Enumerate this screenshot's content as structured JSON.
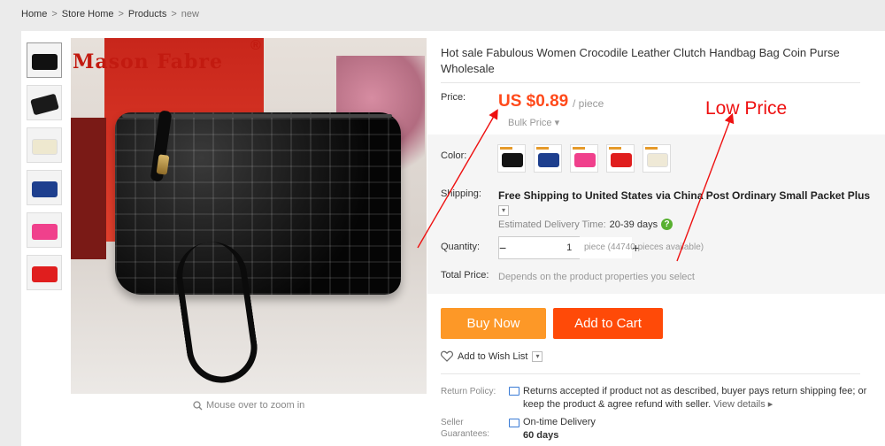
{
  "breadcrumb": {
    "items": [
      "Home",
      "Store Home",
      "Products",
      "new"
    ],
    "separator": ">"
  },
  "product": {
    "title": "Hot sale Fabulous Women Crocodile Leather Clutch Handbag Bag Coin Purse Wholesale",
    "image_brand": "Mason Fabre",
    "image_brand_mark": "®",
    "zoom_hint": "Mouse over to zoom in"
  },
  "price": {
    "label": "Price:",
    "value": "US $0.89",
    "unit": "/ piece",
    "bulk": "Bulk Price ▾"
  },
  "color": {
    "label": "Color:",
    "swatches": [
      {
        "name": "black",
        "hex": "#151515"
      },
      {
        "name": "blue",
        "hex": "#1e3f8e"
      },
      {
        "name": "pink",
        "hex": "#f0408c"
      },
      {
        "name": "red",
        "hex": "#e01e1e"
      },
      {
        "name": "beige",
        "hex": "#efe9d6"
      }
    ]
  },
  "shipping": {
    "label": "Shipping:",
    "text": "Free Shipping to United States via China Post Ordinary Small Packet Plus",
    "caret": "▾",
    "delivery_label": "Estimated Delivery Time:",
    "delivery_days": "20-39 days",
    "help": "?"
  },
  "quantity": {
    "label": "Quantity:",
    "minus": "−",
    "value": "1",
    "plus": "+",
    "note": "piece (44740 pieces available)"
  },
  "total": {
    "label": "Total Price:",
    "text": "Depends on the product properties you select"
  },
  "actions": {
    "buy_now": "Buy Now",
    "add_to_cart": "Add to Cart",
    "wishlist": "Add to Wish List",
    "wishlist_caret": "▾"
  },
  "policy": {
    "return_label": "Return Policy:",
    "return_text": "Returns accepted if product not as described, buyer pays return shipping fee; or keep the product & agree refund with seller.",
    "view_details": "View details ▸",
    "seller_label": "Seller Guarantees:",
    "ontime": "On-time Delivery",
    "days": "60 days"
  },
  "annotation": {
    "text": "Low Price",
    "color": "#ee1111"
  },
  "thumbnails": [
    {
      "name": "black",
      "hex": "#111111"
    },
    {
      "name": "black-open",
      "hex": "#1a1a1a"
    },
    {
      "name": "beige",
      "hex": "#eee8cf"
    },
    {
      "name": "blue",
      "hex": "#1e3f8e"
    },
    {
      "name": "pink",
      "hex": "#f0408c"
    },
    {
      "name": "red",
      "hex": "#e01e1e"
    }
  ],
  "colors": {
    "price": "#ff4a1b",
    "buy_now": "#fd9827",
    "add_to_cart": "#ff4a08"
  }
}
